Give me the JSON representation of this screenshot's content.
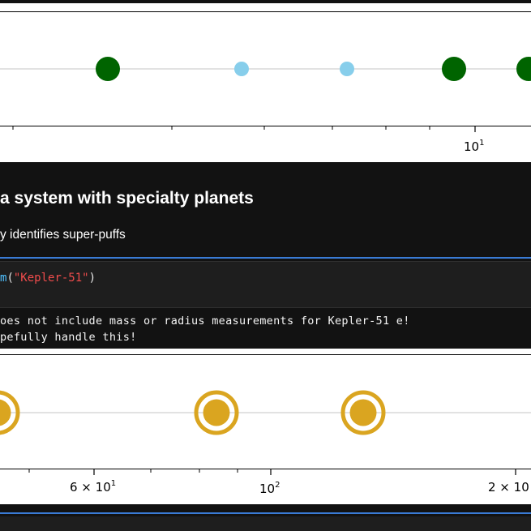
{
  "plot_top": {
    "x_tick_major": "10",
    "x_tick_major_exp": "1",
    "points": [
      {
        "style": "filled-large",
        "color": "#006400"
      },
      {
        "style": "filled-small",
        "color": "#87ceeb"
      },
      {
        "style": "filled-small",
        "color": "#87ceeb"
      },
      {
        "style": "filled-large",
        "color": "#006400"
      },
      {
        "style": "filled-large",
        "color": "#006400"
      }
    ]
  },
  "notebook": {
    "heading": "a system with specialty planets",
    "subtext": "y identifies super-puffs",
    "code": {
      "fn": "m",
      "open_paren": "(",
      "arg": "\"Kepler-51\"",
      "close_paren": ")"
    },
    "output_lines": [
      "oes not include mass or radius measurements for Kepler-51 e!",
      "pefully handle this!"
    ]
  },
  "plot_bottom": {
    "ticks": [
      {
        "base": "6 × 10",
        "exp": "1"
      },
      {
        "base": "10",
        "exp": "2"
      },
      {
        "base": "2 × 10",
        "exp": ""
      }
    ],
    "points": [
      {
        "style": "ringed",
        "color": "#daa520"
      },
      {
        "style": "ringed",
        "color": "#daa520"
      },
      {
        "style": "ringed",
        "color": "#daa520"
      }
    ]
  },
  "colors": {
    "dark_panel": "#121212",
    "accent_rule": "#3a7bd5",
    "grid_line": "#d9d9d9"
  }
}
